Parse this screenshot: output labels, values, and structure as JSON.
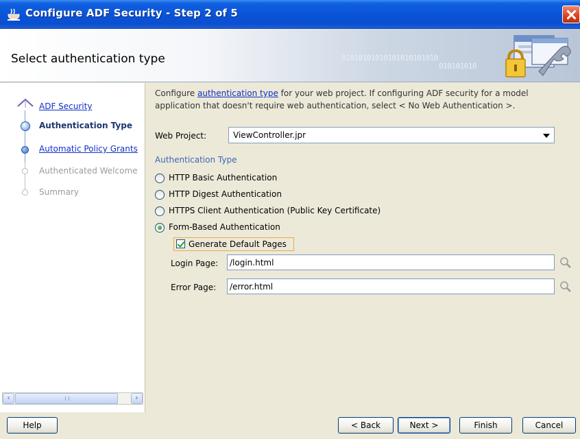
{
  "window": {
    "title": "Configure ADF Security - Step 2 of 5"
  },
  "header": {
    "title": "Select authentication type",
    "binary_text_a": "01010101010101010101010",
    "binary_text_b": "010101010"
  },
  "steps": [
    {
      "label": "ADF Security",
      "state": "link"
    },
    {
      "label": "Authentication Type",
      "state": "current"
    },
    {
      "label": "Automatic Policy Grants",
      "state": "link"
    },
    {
      "label": "Authenticated Welcome",
      "state": "disabled"
    },
    {
      "label": "Summary",
      "state": "disabled"
    }
  ],
  "intro": {
    "prefix": "Configure ",
    "link": "authentication type",
    "suffix": " for your web project. If configuring ADF security for a model application that doesn't require web authentication, select < No Web Authentication >."
  },
  "web_project": {
    "label": "Web Project:",
    "value": "ViewController.jpr"
  },
  "auth_section": {
    "title": "Authentication Type"
  },
  "auth_options": [
    {
      "label": "HTTP Basic Authentication",
      "selected": false
    },
    {
      "label": "HTTP Digest Authentication",
      "selected": false
    },
    {
      "label": "HTTPS Client Authentication (Public Key Certificate)",
      "selected": false
    },
    {
      "label": "Form-Based Authentication",
      "selected": true
    }
  ],
  "generate_default_pages": {
    "label": "Generate Default Pages",
    "checked": true
  },
  "login_page": {
    "label": "Login Page:",
    "value": "/login.html"
  },
  "error_page": {
    "label": "Error Page:",
    "value": "/error.html"
  },
  "buttons": {
    "help": "Help",
    "back": "< Back",
    "next": "Next >",
    "finish": "Finish",
    "cancel": "Cancel"
  },
  "colors": {
    "titlebar": "#0a53d6",
    "link": "#1030c8",
    "section_title": "#3b68b5",
    "focus_outline": "#f0a84a"
  }
}
